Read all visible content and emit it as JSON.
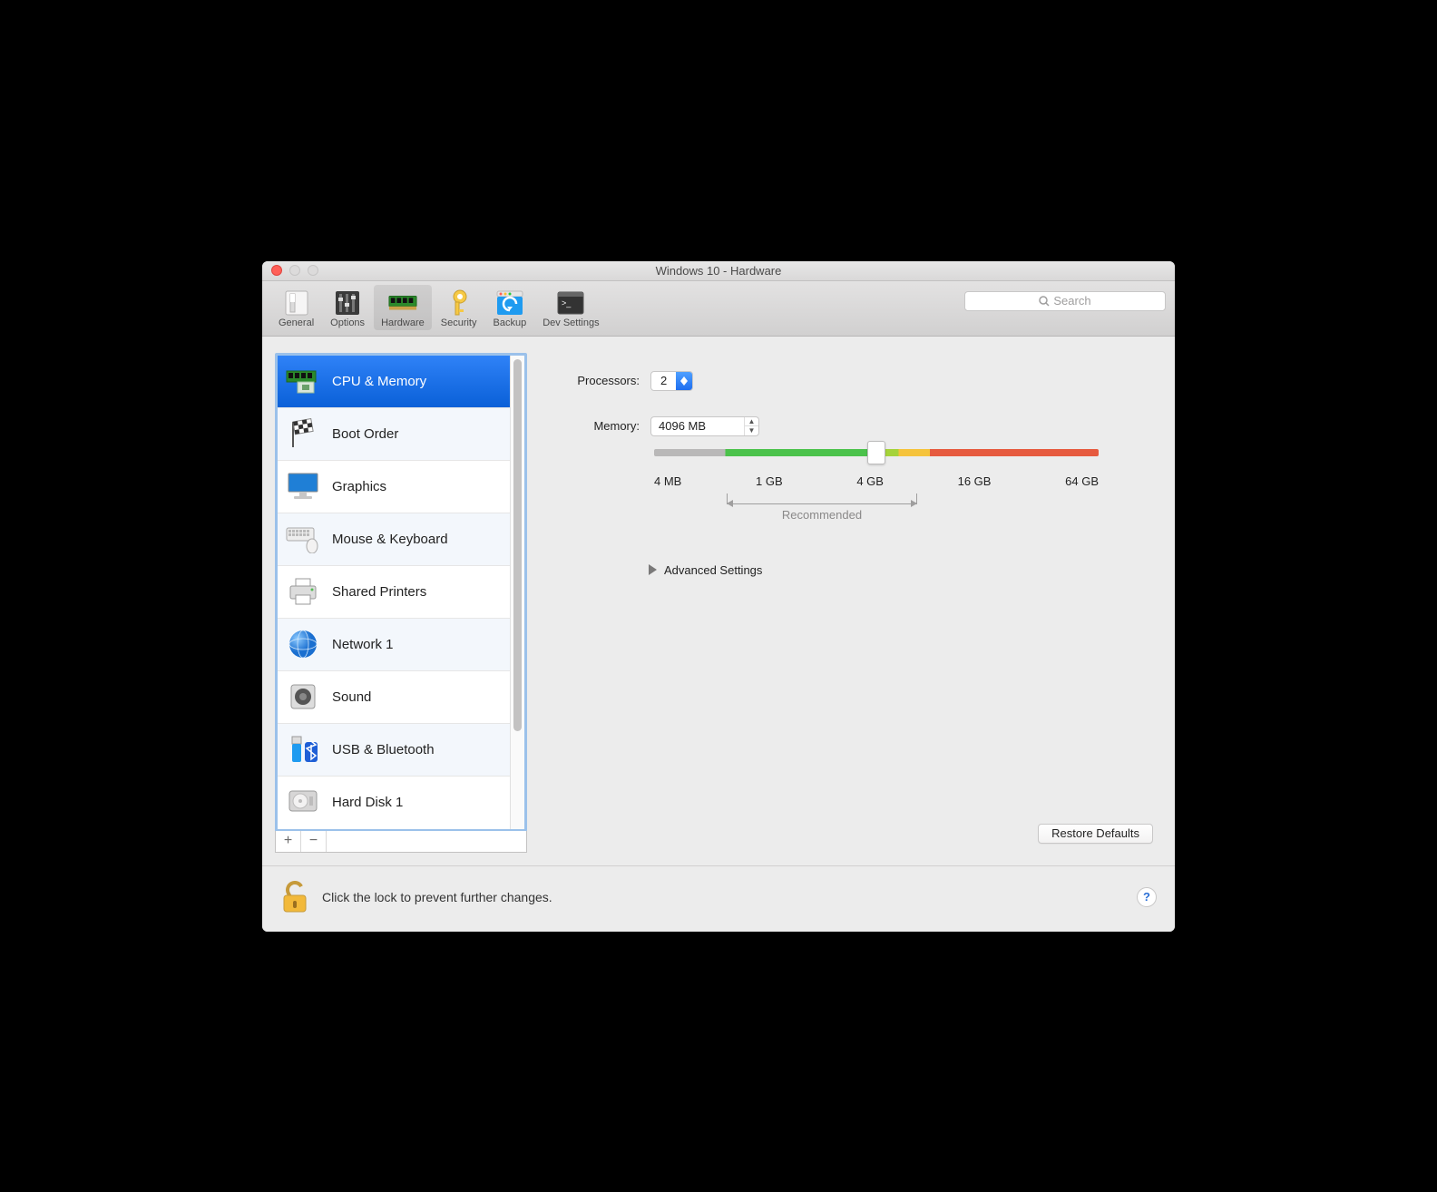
{
  "window": {
    "title": "Windows 10 - Hardware"
  },
  "toolbar": {
    "tabs": [
      {
        "label": "General"
      },
      {
        "label": "Options"
      },
      {
        "label": "Hardware"
      },
      {
        "label": "Security"
      },
      {
        "label": "Backup"
      },
      {
        "label": "Dev Settings"
      }
    ]
  },
  "search": {
    "placeholder": "Search"
  },
  "sidebar": {
    "items": [
      {
        "label": "CPU & Memory"
      },
      {
        "label": "Boot Order"
      },
      {
        "label": "Graphics"
      },
      {
        "label": "Mouse & Keyboard"
      },
      {
        "label": "Shared Printers"
      },
      {
        "label": "Network 1"
      },
      {
        "label": "Sound"
      },
      {
        "label": "USB & Bluetooth"
      },
      {
        "label": "Hard Disk 1"
      }
    ]
  },
  "main": {
    "processors_label": "Processors:",
    "processors_value": "2",
    "memory_label": "Memory:",
    "memory_value": "4096 MB",
    "slider_ticks": [
      "4 MB",
      "1 GB",
      "4 GB",
      "16 GB",
      "64 GB"
    ],
    "recommended_label": "Recommended",
    "advanced_label": "Advanced Settings",
    "restore_label": "Restore Defaults"
  },
  "lockbar": {
    "text": "Click the lock to prevent further changes."
  }
}
